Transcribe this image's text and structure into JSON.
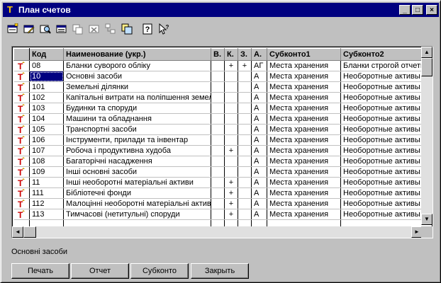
{
  "window": {
    "title": "План счетов",
    "title_icon": "T",
    "controls": {
      "minimize": "_",
      "maximize": "□",
      "close": "×"
    }
  },
  "toolbar": {
    "icons": [
      "new-account-icon",
      "edit-icon",
      "search-icon",
      "filter-icon",
      "copy-icon",
      "delete-icon",
      "hierarchy-icon",
      "tree-icon",
      "help-icon",
      "context-help-icon"
    ],
    "help_glyph": "?"
  },
  "grid": {
    "columns": [
      "Код",
      "Наименование (укр.)",
      "В.",
      "К.",
      "З.",
      "А.",
      "Субконто1",
      "Субконто2"
    ],
    "rows": [
      {
        "code": "08",
        "name": "Бланки суворого обліку",
        "v": "",
        "k": "+",
        "z": "+",
        "a": "АГ",
        "s1": "Места хранения",
        "s2": "Бланки строгой отчетн"
      },
      {
        "code": "10",
        "name": "Основні засоби",
        "v": "",
        "k": "",
        "z": "",
        "a": "А",
        "s1": "Места хранения",
        "s2": "Необоротные активы"
      },
      {
        "code": "101",
        "name": "Земельні ділянки",
        "v": "",
        "k": "",
        "z": "",
        "a": "А",
        "s1": "Места хранения",
        "s2": "Необоротные активы"
      },
      {
        "code": "102",
        "name": "Капітальні витрати на поліпшення земель",
        "v": "",
        "k": "",
        "z": "",
        "a": "А",
        "s1": "Места хранения",
        "s2": "Необоротные активы"
      },
      {
        "code": "103",
        "name": "Будинки та споруди",
        "v": "",
        "k": "",
        "z": "",
        "a": "А",
        "s1": "Места хранения",
        "s2": "Необоротные активы"
      },
      {
        "code": "104",
        "name": "Машини та обладнання",
        "v": "",
        "k": "",
        "z": "",
        "a": "А",
        "s1": "Места хранения",
        "s2": "Необоротные активы"
      },
      {
        "code": "105",
        "name": "Транспортні засоби",
        "v": "",
        "k": "",
        "z": "",
        "a": "А",
        "s1": "Места хранения",
        "s2": "Необоротные активы"
      },
      {
        "code": "106",
        "name": "Інструменти, прилади та інвентар",
        "v": "",
        "k": "",
        "z": "",
        "a": "А",
        "s1": "Места хранения",
        "s2": "Необоротные активы"
      },
      {
        "code": "107",
        "name": "Робоча і продуктивна худоба",
        "v": "",
        "k": "+",
        "z": "",
        "a": "А",
        "s1": "Места хранения",
        "s2": "Необоротные активы"
      },
      {
        "code": "108",
        "name": "Багаторічні насадження",
        "v": "",
        "k": "",
        "z": "",
        "a": "А",
        "s1": "Места хранения",
        "s2": "Необоротные активы"
      },
      {
        "code": "109",
        "name": "Інші основні засоби",
        "v": "",
        "k": "",
        "z": "",
        "a": "А",
        "s1": "Места хранения",
        "s2": "Необоротные активы"
      },
      {
        "code": "11",
        "name": "Інші необоротні матеріальні активи",
        "v": "",
        "k": "+",
        "z": "",
        "a": "А",
        "s1": "Места хранения",
        "s2": "Необоротные активы"
      },
      {
        "code": "111",
        "name": "Бібліотечні фонди",
        "v": "",
        "k": "+",
        "z": "",
        "a": "А",
        "s1": "Места хранения",
        "s2": "Необоротные активы"
      },
      {
        "code": "112",
        "name": "Малоцінні необоротні матеріальні активи",
        "v": "",
        "k": "+",
        "z": "",
        "a": "А",
        "s1": "Места хранения",
        "s2": "Необоротные активы"
      },
      {
        "code": "113",
        "name": "Тимчасові (нетитульні) споруди",
        "v": "",
        "k": "+",
        "z": "",
        "a": "А",
        "s1": "Места хранения",
        "s2": "Необоротные активы"
      }
    ],
    "selected_row": 1
  },
  "scroll": {
    "up": "▲",
    "down": "▼",
    "left": "◄",
    "right": "►"
  },
  "status": {
    "text": "Основні засоби"
  },
  "buttons": [
    {
      "label": "Печать"
    },
    {
      "label": "Отчет"
    },
    {
      "label": "Субконто"
    },
    {
      "label": "Закрыть"
    }
  ],
  "colors": {
    "titlebar": "#000080",
    "selection": "#000080",
    "face": "#c0c0c0"
  }
}
